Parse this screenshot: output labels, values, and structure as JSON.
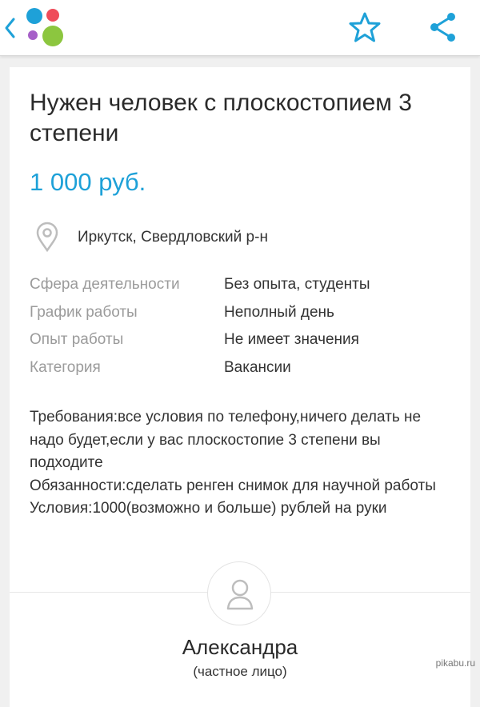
{
  "header": {
    "back_icon": "chevron-left-icon",
    "logo_icon": "avito-logo-dots",
    "favorite_icon": "star-outline-icon",
    "share_icon": "share-icon",
    "logo_colors": [
      "#1ea1d8",
      "#ef4c5a",
      "#a660c8",
      "#8cc63f"
    ],
    "accent": "#1ea1d8"
  },
  "listing": {
    "title": "Нужен человек с плоскостопием 3 степени",
    "price": "1 000 руб.",
    "location": "Иркутск, Свердловский р-н",
    "params": [
      {
        "label": "Сфера деятельности",
        "value": "Без опыта, студенты"
      },
      {
        "label": "График работы",
        "value": "Неполный день"
      },
      {
        "label": "Опыт работы",
        "value": "Не имеет значения"
      },
      {
        "label": "Категория",
        "value": "Вакансии"
      }
    ],
    "description": [
      "Требования:все условия по телефону,ничего делать не надо будет,если у вас плоскостопие 3 степени вы подходите",
      "Обязанности:сделать ренген снимок для научной работы",
      "Условия:1000(возможно и больше) рублей на руки"
    ]
  },
  "seller": {
    "name": "Александра",
    "type": "(частное лицо)"
  },
  "watermark": "pikabu.ru"
}
